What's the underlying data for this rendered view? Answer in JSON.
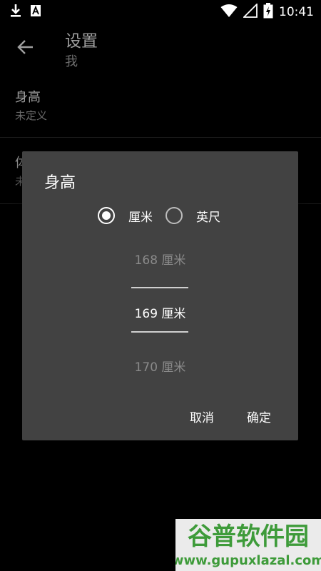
{
  "status_bar": {
    "time": "10:41",
    "icons": [
      "download-icon",
      "a-notification-icon",
      "wifi-icon",
      "signal-icon",
      "battery-icon"
    ]
  },
  "app_bar": {
    "title": "设置",
    "subtitle": "我"
  },
  "prefs": [
    {
      "title": "身高",
      "summary": "未定义"
    },
    {
      "title": "体",
      "summary": "未"
    }
  ],
  "dialog": {
    "title": "身高",
    "units": [
      {
        "label": "厘米",
        "checked": true
      },
      {
        "label": "英尺",
        "checked": false
      }
    ],
    "picker": {
      "prev": "168 厘米",
      "current": "169 厘米",
      "next": "170 厘米"
    },
    "cancel_label": "取消",
    "ok_label": "确定"
  },
  "watermark": {
    "text_cn": "谷普软件园",
    "text_url": "www.gupuxlazal.com"
  },
  "colors": {
    "background": "#000000",
    "dialog": "#424242",
    "watermark_green": "#3e9b3a"
  }
}
